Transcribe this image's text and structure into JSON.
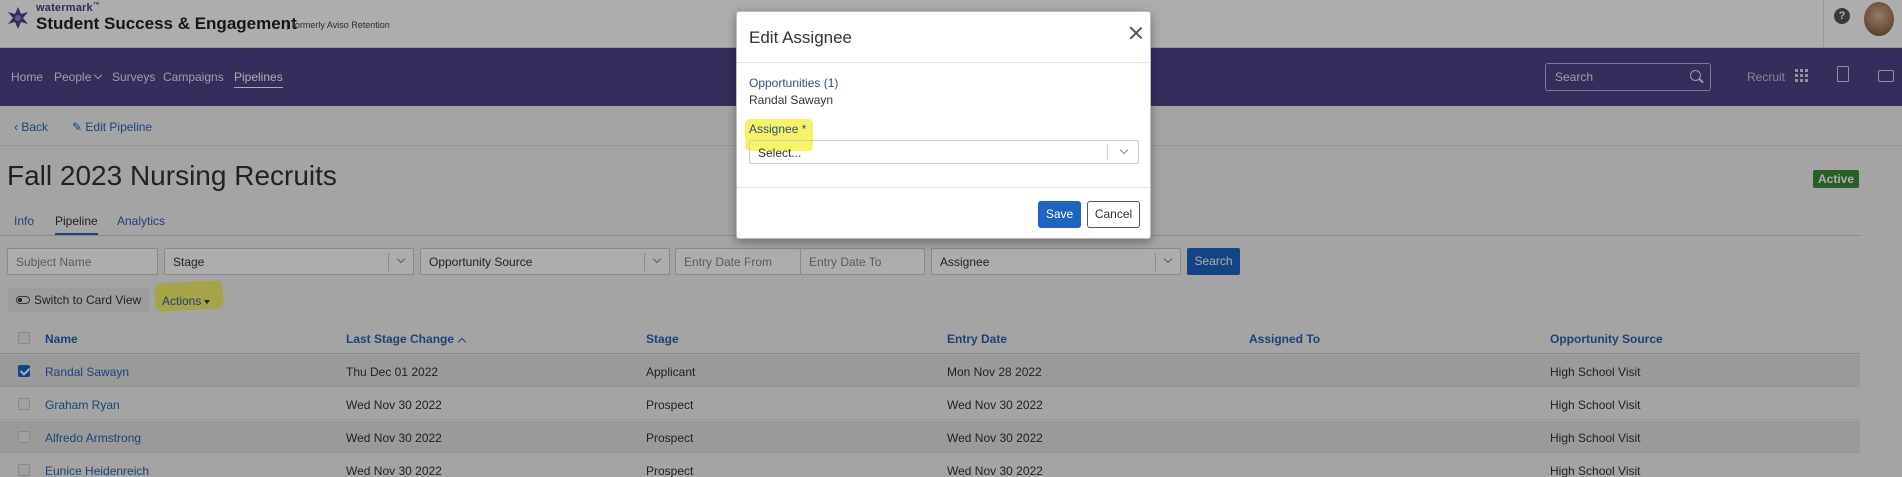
{
  "header": {
    "brand_small": "watermark",
    "brand_tm": "™",
    "brand_main": "Student Success & Engagement",
    "brand_sep": "|",
    "brand_former": "formerly Aviso Retention",
    "help_glyph": "?"
  },
  "nav": {
    "items": [
      {
        "label": "Home"
      },
      {
        "label": "People"
      },
      {
        "label": "Surveys"
      },
      {
        "label": "Campaigns"
      },
      {
        "label": "Pipelines"
      }
    ],
    "active_item": "Pipelines",
    "search_placeholder": "Search",
    "recruit_label": "Recruit"
  },
  "subbar": {
    "back_label": "Back",
    "edit_label": "Edit Pipeline"
  },
  "page": {
    "title": "Fall 2023 Nursing Recruits",
    "status": "Active",
    "status_color": "#3c8c3a",
    "tabs": [
      {
        "label": "Info"
      },
      {
        "label": "Pipeline"
      },
      {
        "label": "Analytics"
      }
    ],
    "active_tab": "Pipeline"
  },
  "filters": {
    "subject_name_placeholder": "Subject Name",
    "stage_value": "Stage",
    "opportunity_source_value": "Opportunity Source",
    "entry_date_from_placeholder": "Entry Date From",
    "entry_date_to_placeholder": "Entry Date To",
    "assignee_value": "Assignee",
    "search_button": "Search"
  },
  "toolbar": {
    "switch_view_label": "Switch to Card View",
    "actions_label": "Actions"
  },
  "table": {
    "columns": [
      "Name",
      "Last Stage Change",
      "Stage",
      "Entry Date",
      "Assigned To",
      "Opportunity Source"
    ],
    "rows": [
      {
        "name": "Randal Sawayn",
        "last_stage_change": "Thu Dec 01 2022",
        "stage": "Applicant",
        "entry_date": "Mon Nov 28 2022",
        "assigned_to": "",
        "source": "High School Visit",
        "checked": true
      },
      {
        "name": "Graham Ryan",
        "last_stage_change": "Wed Nov 30 2022",
        "stage": "Prospect",
        "entry_date": "Wed Nov 30 2022",
        "assigned_to": "",
        "source": "High School Visit",
        "checked": false
      },
      {
        "name": "Alfredo Armstrong",
        "last_stage_change": "Wed Nov 30 2022",
        "stage": "Prospect",
        "entry_date": "Wed Nov 30 2022",
        "assigned_to": "",
        "source": "High School Visit",
        "checked": false
      },
      {
        "name": "Eunice Heidenreich",
        "last_stage_change": "Wed Nov 30 2022",
        "stage": "Prospect",
        "entry_date": "Wed Nov 30 2022",
        "assigned_to": "",
        "source": "High School Visit",
        "checked": false
      }
    ]
  },
  "modal": {
    "title": "Edit Assignee",
    "opportunities_label": "Opportunities (1)",
    "opportunity_name": "Randal Sawayn",
    "assignee_label": "Assignee *",
    "assignee_placeholder": "Select...",
    "save_label": "Save",
    "cancel_label": "Cancel"
  },
  "colors": {
    "nav_bg": "#4e4488",
    "primary_button": "#1d65c1",
    "link": "#2b63b6",
    "highlight": "#f6ef3f"
  }
}
